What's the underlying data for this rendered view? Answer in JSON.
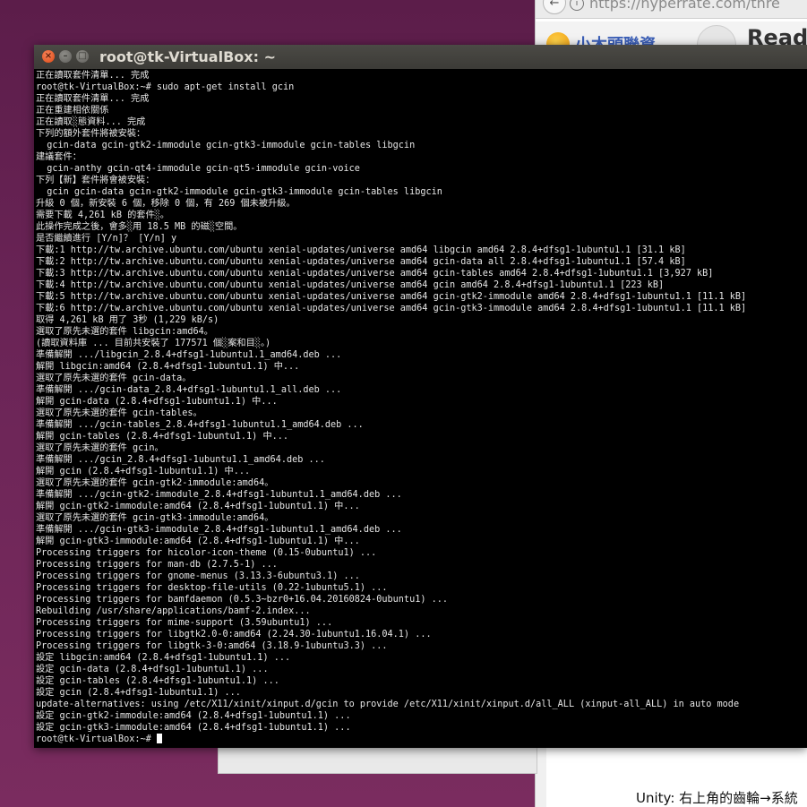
{
  "browser": {
    "url": "https://hyperrate.com/thre",
    "site_logo_text": "小木頭聯資",
    "reader_label": "Read",
    "unity_note": "Unity: 右上角的齒輪→系統"
  },
  "terminal": {
    "title": "root@tk-VirtualBox: ~",
    "lines": [
      "正在讀取套件清單... 完成",
      "root@tk-VirtualBox:~# sudo apt-get install gcin",
      "正在讀取套件清單... 完成",
      "正在重建相依關係",
      "正在讀取░態資料... 完成",
      "下列的額外套件將被安裝：",
      "  gcin-data gcin-gtk2-immodule gcin-gtk3-immodule gcin-tables libgcin",
      "建議套件：",
      "  gcin-anthy gcin-qt4-immodule gcin-qt5-immodule gcin-voice",
      "下列【新】套件將會被安裝：",
      "  gcin gcin-data gcin-gtk2-immodule gcin-gtk3-immodule gcin-tables libgcin",
      "升級 0 個，新安裝 6 個，移除 0 個，有 269 個未被升級。",
      "需要下載 4,261 kB 的套件░。",
      "此操作完成之後，會多░用 18.5 MB 的磁░空間。",
      "是否繼續進行 [Y/n]？ [Y/n] y",
      "下載:1 http://tw.archive.ubuntu.com/ubuntu xenial-updates/universe amd64 libgcin amd64 2.8.4+dfsg1-1ubuntu1.1 [31.1 kB]",
      "下載:2 http://tw.archive.ubuntu.com/ubuntu xenial-updates/universe amd64 gcin-data all 2.8.4+dfsg1-1ubuntu1.1 [57.4 kB]",
      "下載:3 http://tw.archive.ubuntu.com/ubuntu xenial-updates/universe amd64 gcin-tables amd64 2.8.4+dfsg1-1ubuntu1.1 [3,927 kB]",
      "下載:4 http://tw.archive.ubuntu.com/ubuntu xenial-updates/universe amd64 gcin amd64 2.8.4+dfsg1-1ubuntu1.1 [223 kB]",
      "下載:5 http://tw.archive.ubuntu.com/ubuntu xenial-updates/universe amd64 gcin-gtk2-immodule amd64 2.8.4+dfsg1-1ubuntu1.1 [11.1 kB]",
      "下載:6 http://tw.archive.ubuntu.com/ubuntu xenial-updates/universe amd64 gcin-gtk3-immodule amd64 2.8.4+dfsg1-1ubuntu1.1 [11.1 kB]",
      "取得 4,261 kB 用了 3秒 (1,229 kB/s)",
      "選取了原先未選的套件 libgcin:amd64。",
      "(讀取資料庫 ... 目前共安裝了 177571 個░案和目░。)",
      "準備解開 .../libgcin_2.8.4+dfsg1-1ubuntu1.1_amd64.deb ...",
      "解開 libgcin:amd64 (2.8.4+dfsg1-1ubuntu1.1) 中...",
      "選取了原先未選的套件 gcin-data。",
      "準備解開 .../gcin-data_2.8.4+dfsg1-1ubuntu1.1_all.deb ...",
      "解開 gcin-data (2.8.4+dfsg1-1ubuntu1.1) 中...",
      "選取了原先未選的套件 gcin-tables。",
      "準備解開 .../gcin-tables_2.8.4+dfsg1-1ubuntu1.1_amd64.deb ...",
      "解開 gcin-tables (2.8.4+dfsg1-1ubuntu1.1) 中...",
      "選取了原先未選的套件 gcin。",
      "準備解開 .../gcin_2.8.4+dfsg1-1ubuntu1.1_amd64.deb ...",
      "解開 gcin (2.8.4+dfsg1-1ubuntu1.1) 中...",
      "選取了原先未選的套件 gcin-gtk2-immodule:amd64。",
      "準備解開 .../gcin-gtk2-immodule_2.8.4+dfsg1-1ubuntu1.1_amd64.deb ...",
      "解開 gcin-gtk2-immodule:amd64 (2.8.4+dfsg1-1ubuntu1.1) 中...",
      "選取了原先未選的套件 gcin-gtk3-immodule:amd64。",
      "準備解開 .../gcin-gtk3-immodule_2.8.4+dfsg1-1ubuntu1.1_amd64.deb ...",
      "解開 gcin-gtk3-immodule:amd64 (2.8.4+dfsg1-1ubuntu1.1) 中...",
      "Processing triggers for hicolor-icon-theme (0.15-0ubuntu1) ...",
      "Processing triggers for man-db (2.7.5-1) ...",
      "Processing triggers for gnome-menus (3.13.3-6ubuntu3.1) ...",
      "Processing triggers for desktop-file-utils (0.22-1ubuntu5.1) ...",
      "Processing triggers for bamfdaemon (0.5.3~bzr0+16.04.20160824-0ubuntu1) ...",
      "Rebuilding /usr/share/applications/bamf-2.index...",
      "Processing triggers for mime-support (3.59ubuntu1) ...",
      "Processing triggers for libgtk2.0-0:amd64 (2.24.30-1ubuntu1.16.04.1) ...",
      "Processing triggers for libgtk-3-0:amd64 (3.18.9-1ubuntu3.3) ...",
      "設定 libgcin:amd64 (2.8.4+dfsg1-1ubuntu1.1) ...",
      "設定 gcin-data (2.8.4+dfsg1-1ubuntu1.1) ...",
      "設定 gcin-tables (2.8.4+dfsg1-1ubuntu1.1) ...",
      "設定 gcin (2.8.4+dfsg1-1ubuntu1.1) ...",
      "update-alternatives: using /etc/X11/xinit/xinput.d/gcin to provide /etc/X11/xinit/xinput.d/all_ALL (xinput-all_ALL) in auto mode",
      "設定 gcin-gtk2-immodule:amd64 (2.8.4+dfsg1-1ubuntu1.1) ...",
      "設定 gcin-gtk3-immodule:amd64 (2.8.4+dfsg1-1ubuntu1.1) ..."
    ],
    "prompt": "root@tk-VirtualBox:~# "
  },
  "icons": {
    "close": "close-icon",
    "minimize": "minimize-icon",
    "maximize": "maximize-icon",
    "back": "back-arrow-icon",
    "info": "info-icon",
    "logo": "sun-logo-icon",
    "reader": "reader-mode-icon"
  },
  "colors": {
    "desktop": "#6a2456",
    "titlebar": "#3c3b37",
    "close_button": "#dd4814",
    "terminal_bg": "#000000",
    "terminal_fg": "#e6e6e6"
  }
}
